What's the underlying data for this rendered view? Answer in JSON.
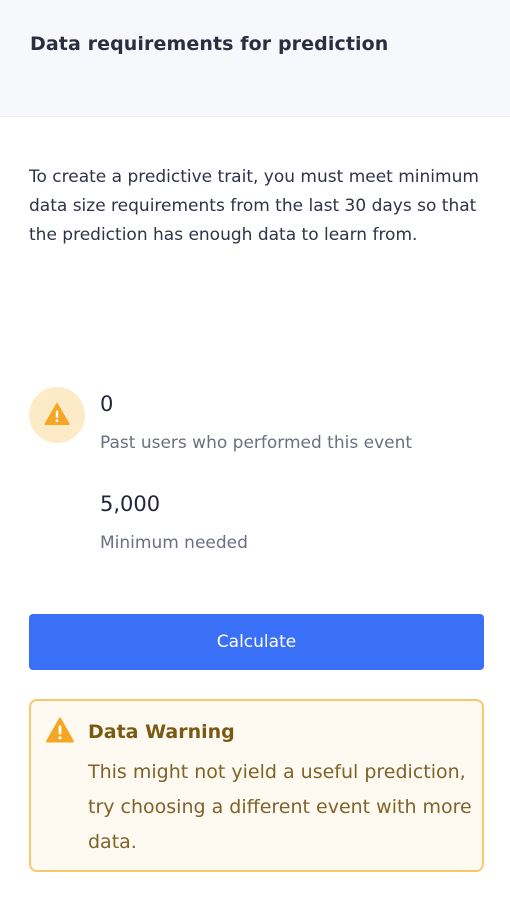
{
  "header": {
    "title": "Data requirements for prediction"
  },
  "description": "To create a predictive trait, you must meet minimum data size requirements from the last 30 days so that the prediction has enough data to learn from.",
  "stats": {
    "past_users_value": "0",
    "past_users_label": "Past users who performed this event",
    "minimum_value": "5,000",
    "minimum_label": "Minimum needed"
  },
  "actions": {
    "calculate_label": "Calculate"
  },
  "alert": {
    "title": "Data Warning",
    "message": "This might not yield a useful prediction, try choosing a different event with more data."
  },
  "colors": {
    "primary_button": "#3a6ff8",
    "warning_accent": "#f5a623",
    "warning_border": "#f7c968",
    "warning_bg": "#fffaf1",
    "header_bg": "#f6f8fc"
  },
  "icons": {
    "stat_warning": "warning-triangle-icon",
    "alert_warning": "warning-triangle-icon"
  }
}
